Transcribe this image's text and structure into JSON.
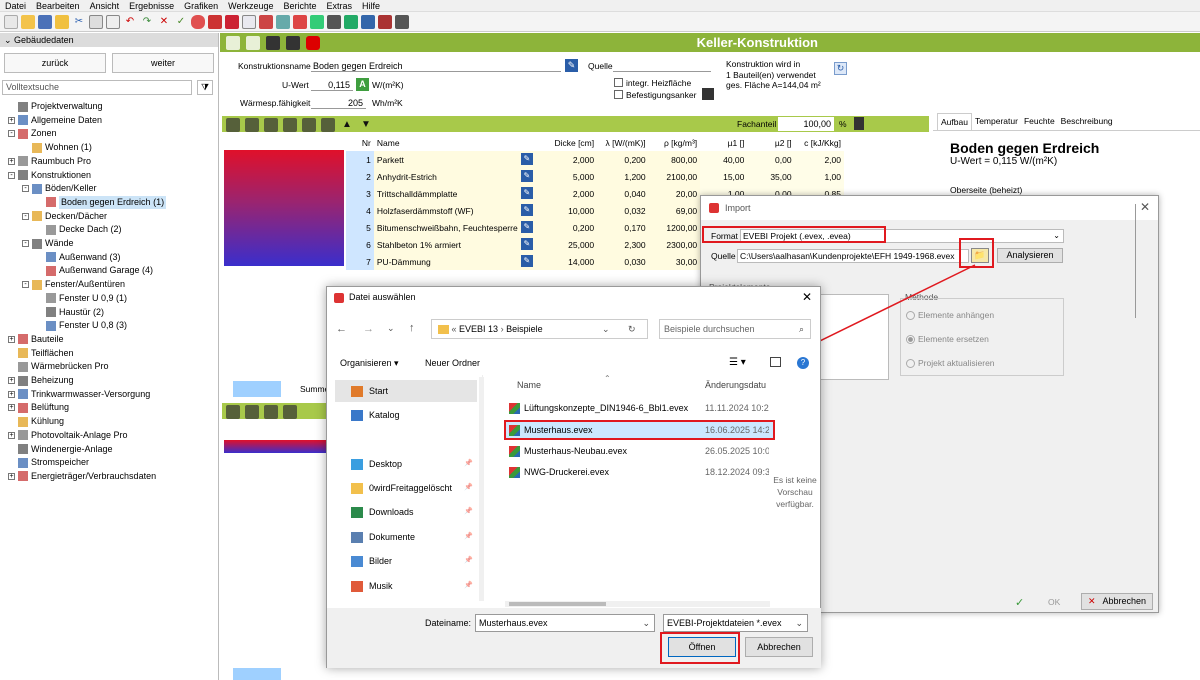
{
  "menubar": [
    "Datei",
    "Bearbeiten",
    "Ansicht",
    "Ergebnisse",
    "Grafiken",
    "Werkzeuge",
    "Berichte",
    "Extras",
    "Hilfe"
  ],
  "left": {
    "header": "Gebäudedaten",
    "back_label": "zurück",
    "next_label": "weiter",
    "search_placeholder": "Volltextsuche",
    "tree": [
      {
        "label": "Projektverwaltung",
        "level": 0,
        "exp": ""
      },
      {
        "label": "Allgemeine Daten",
        "level": 0,
        "exp": "+"
      },
      {
        "label": "Zonen",
        "level": 0,
        "exp": "-"
      },
      {
        "label": "Wohnen (1)",
        "level": 1,
        "exp": ""
      },
      {
        "label": "Raumbuch Pro",
        "level": 0,
        "exp": "+"
      },
      {
        "label": "Konstruktionen",
        "level": 0,
        "exp": "-"
      },
      {
        "label": "Böden/Keller",
        "level": 1,
        "exp": "-"
      },
      {
        "label": "Boden gegen Erdreich (1)",
        "level": 2,
        "exp": "",
        "selected": true
      },
      {
        "label": "Decken/Dächer",
        "level": 1,
        "exp": "-"
      },
      {
        "label": "Decke Dach (2)",
        "level": 2,
        "exp": ""
      },
      {
        "label": "Wände",
        "level": 1,
        "exp": "-"
      },
      {
        "label": "Außenwand (3)",
        "level": 2,
        "exp": ""
      },
      {
        "label": "Außenwand Garage (4)",
        "level": 2,
        "exp": ""
      },
      {
        "label": "Fenster/Außentüren",
        "level": 1,
        "exp": "-"
      },
      {
        "label": "Fenster U 0,9 (1)",
        "level": 2,
        "exp": ""
      },
      {
        "label": "Haustür (2)",
        "level": 2,
        "exp": ""
      },
      {
        "label": "Fenster U 0,8 (3)",
        "level": 2,
        "exp": ""
      },
      {
        "label": "Bauteile",
        "level": 0,
        "exp": "+"
      },
      {
        "label": "Teilflächen",
        "level": 0,
        "exp": ""
      },
      {
        "label": "Wärmebrücken Pro",
        "level": 0,
        "exp": ""
      },
      {
        "label": "Beheizung",
        "level": 0,
        "exp": "+"
      },
      {
        "label": "Trinkwarmwasser-Versorgung",
        "level": 0,
        "exp": "+"
      },
      {
        "label": "Belüftung",
        "level": 0,
        "exp": "+"
      },
      {
        "label": "Kühlung",
        "level": 0,
        "exp": ""
      },
      {
        "label": "Photovoltaik-Anlage Pro",
        "level": 0,
        "exp": "+"
      },
      {
        "label": "Windenergie-Anlage",
        "level": 0,
        "exp": ""
      },
      {
        "label": "Stromspeicher",
        "level": 0,
        "exp": ""
      },
      {
        "label": "Energieträger/Verbrauchsdaten",
        "level": 0,
        "exp": "+"
      }
    ]
  },
  "main": {
    "title": "Keller-Konstruktion",
    "konstruktionsname_label": "Konstruktionsname",
    "konstruktionsname": "Boden gegen Erdreich",
    "quelle_label": "Quelle",
    "uwert_label": "U-Wert",
    "uwert": "0,115",
    "uwert_badge": "A",
    "uwert_unit": "W/(m²K)",
    "wsf_label": "Wärmesp.fähigkeit",
    "wsf": "205",
    "wsf_unit": "Wh/m²K",
    "integr_label": "integr. Heizfläche",
    "befest_label": "Befestigungsanker",
    "info_line1": "Konstruktion wird in",
    "info_line2": "1 Bauteil(en) verwendet",
    "info_line3": "ges. Fläche A=144,04 m²",
    "fachanteil_label": "Fachanteil",
    "fachanteil": "100,00",
    "fachanteil_unit": "%",
    "columns": [
      "Nr",
      "Name",
      "Dicke [cm]",
      "λ [W/(mK)]",
      "ρ [kg/m³]",
      "µ1 []",
      "µ2 []",
      "c [kJ/Kkg]"
    ],
    "rows": [
      {
        "nr": "1",
        "name": "Parkett",
        "dicke": "2,000",
        "lambda": "0,200",
        "rho": "800,00",
        "mu1": "40,00",
        "mu2": "0,00",
        "c": "2,00"
      },
      {
        "nr": "2",
        "name": "Anhydrit-Estrich",
        "dicke": "5,000",
        "lambda": "1,200",
        "rho": "2100,00",
        "mu1": "15,00",
        "mu2": "35,00",
        "c": "1,00"
      },
      {
        "nr": "3",
        "name": "Trittschalldämmplatte",
        "dicke": "2,000",
        "lambda": "0,040",
        "rho": "20,00",
        "mu1": "1,00",
        "mu2": "0,00",
        "c": "0,85"
      },
      {
        "nr": "4",
        "name": "Holzfaserdämmstoff (WF)",
        "dicke": "10,000",
        "lambda": "0,032",
        "rho": "69,00",
        "mu1": "",
        "mu2": "",
        "c": ""
      },
      {
        "nr": "5",
        "name": "Bitumenschweißbahn, Feuchtesperre",
        "dicke": "0,200",
        "lambda": "0,170",
        "rho": "1200,00",
        "mu1": "",
        "mu2": "",
        "c": ""
      },
      {
        "nr": "6",
        "name": "Stahlbeton 1% armiert",
        "dicke": "25,000",
        "lambda": "2,300",
        "rho": "2300,00",
        "mu1": "",
        "mu2": "",
        "c": ""
      },
      {
        "nr": "7",
        "name": "PU-Dämmung",
        "dicke": "14,000",
        "lambda": "0,030",
        "rho": "30,00",
        "mu1": "",
        "mu2": "",
        "c": ""
      }
    ],
    "summe_label": "Summe"
  },
  "right": {
    "tabs": [
      "Aufbau",
      "Temperatur",
      "Feuchte",
      "Beschreibung"
    ],
    "title": "Boden gegen Erdreich",
    "uwert_text": "U-Wert = 0,115 W/(m²K)",
    "oberseite": "Oberseite (beheizt)"
  },
  "import": {
    "title": "Import",
    "format_label": "Format",
    "format_value": "EVEBI Projekt (.evex, .evea)",
    "quelle_label": "Quelle",
    "quelle_value": "C:\\Users\\aalhasan\\Kundenprojekte\\EFH 1949-1968.evex",
    "analyse_label": "Analysieren",
    "elements_label": "Projektelemente",
    "methode_label": "Methode",
    "methode_options": [
      "Elemente anhängen",
      "Elemente ersetzen",
      "Projekt aktualisieren"
    ],
    "ok_label": "OK",
    "cancel_label": "Abbrechen"
  },
  "filedlg": {
    "title": "Datei auswählen",
    "path": [
      "EVEBI 13",
      "Beispiele"
    ],
    "search_placeholder": "Beispiele durchsuchen",
    "organize_label": "Organisieren",
    "new_folder_label": "Neuer Ordner",
    "quick_access": [
      {
        "label": "Start",
        "icon": "home-icon",
        "selected": true
      },
      {
        "label": "Katalog",
        "icon": "gallery-icon"
      },
      {
        "label": "Desktop",
        "icon": "desktop-icon"
      },
      {
        "label": "0wirdFreitaggelöscht",
        "icon": "folder-icon"
      },
      {
        "label": "Downloads",
        "icon": "download-icon"
      },
      {
        "label": "Dokumente",
        "icon": "documents-icon"
      },
      {
        "label": "Bilder",
        "icon": "pictures-icon"
      },
      {
        "label": "Musik",
        "icon": "music-icon"
      }
    ],
    "col_name": "Name",
    "col_date": "Änderungsdatu",
    "files": [
      {
        "name": "Lüftungskonzepte_DIN1946-6_Bbl1.evex",
        "date": "11.11.2024 10:2"
      },
      {
        "name": "Musterhaus.evex",
        "date": "16.06.2025 14:2",
        "selected": true
      },
      {
        "name": "Musterhaus-Neubau.evex",
        "date": "26.05.2025 10:0"
      },
      {
        "name": "NWG-Druckerei.evex",
        "date": "18.12.2024 09:3"
      }
    ],
    "no_preview": [
      "Es ist keine",
      "Vorschau",
      "verfügbar."
    ],
    "filename_label": "Dateiname:",
    "filename_value": "Musterhaus.evex",
    "filetype_value": "EVEBI-Projektdateien *.evex",
    "open_label": "Öffnen",
    "cancel_label": "Abbrechen"
  },
  "colors": {
    "green": "#8db43a",
    "red_highlight": "#e0191f",
    "selection": "#cce8ff"
  }
}
